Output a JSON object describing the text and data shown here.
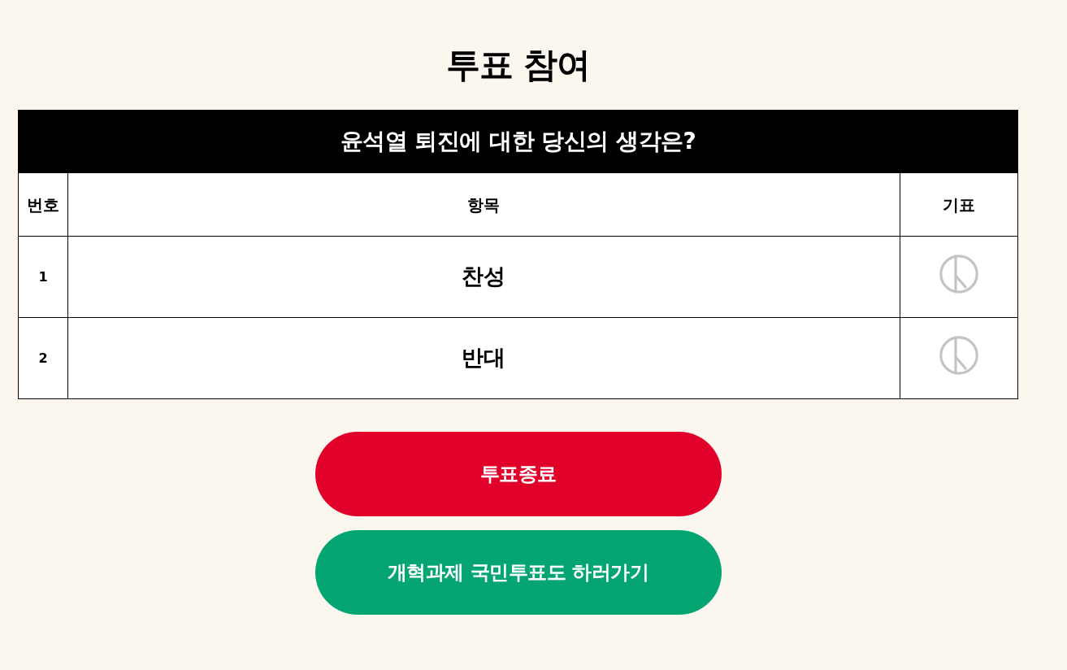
{
  "title": "투표 참여",
  "poll": {
    "question": "윤석열 퇴진에 대한 당신의 생각은?",
    "columns": [
      "번호",
      "항목",
      "기표"
    ],
    "options": [
      {
        "number": "1",
        "label": "찬성"
      },
      {
        "number": "2",
        "label": "반대"
      }
    ]
  },
  "buttons": [
    {
      "label": "투표종료",
      "kind": "end"
    },
    {
      "label": "개혁과제 국민투표도 하러가기",
      "kind": "link"
    }
  ]
}
